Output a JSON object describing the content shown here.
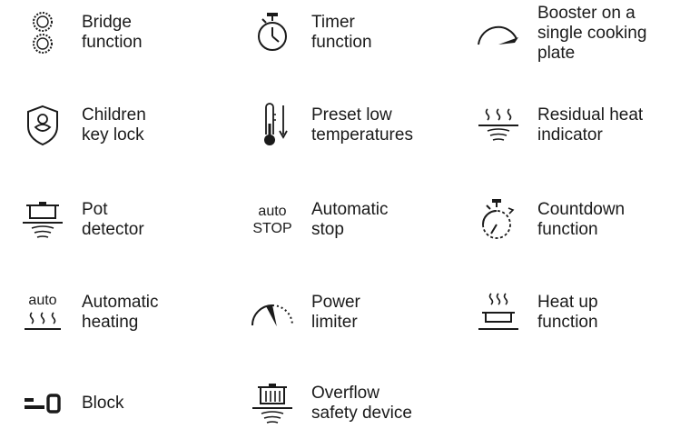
{
  "features": [
    {
      "id": "bridge",
      "label": "Bridge\nfunction",
      "icon": "bridge-icon"
    },
    {
      "id": "timer",
      "label": "Timer\nfunction",
      "icon": "timer-icon"
    },
    {
      "id": "booster",
      "label": "Booster on a\nsingle cooking\nplate",
      "icon": "booster-icon"
    },
    {
      "id": "children-lock",
      "label": "Children\nkey lock",
      "icon": "child-lock-icon"
    },
    {
      "id": "preset-low",
      "label": "Preset low\ntemperatures",
      "icon": "thermometer-icon"
    },
    {
      "id": "residual-heat",
      "label": "Residual heat\nindicator",
      "icon": "residual-heat-icon"
    },
    {
      "id": "pot-detector",
      "label": "Pot\ndetector",
      "icon": "pot-detector-icon"
    },
    {
      "id": "auto-stop",
      "label": "Automatic\nstop",
      "icon": "auto-stop-icon",
      "icon_text": "auto\nSTOP"
    },
    {
      "id": "countdown",
      "label": "Countdown\nfunction",
      "icon": "countdown-icon"
    },
    {
      "id": "auto-heating",
      "label": "Automatic\nheating",
      "icon": "auto-heating-icon",
      "icon_text": "auto"
    },
    {
      "id": "power-limiter",
      "label": "Power\nlimiter",
      "icon": "power-limiter-icon"
    },
    {
      "id": "heat-up",
      "label": "Heat up\nfunction",
      "icon": "heat-up-icon"
    },
    {
      "id": "block",
      "label": "Block",
      "icon": "block-icon"
    },
    {
      "id": "overflow",
      "label": "Overflow\nsafety device",
      "icon": "overflow-safety-icon"
    }
  ]
}
